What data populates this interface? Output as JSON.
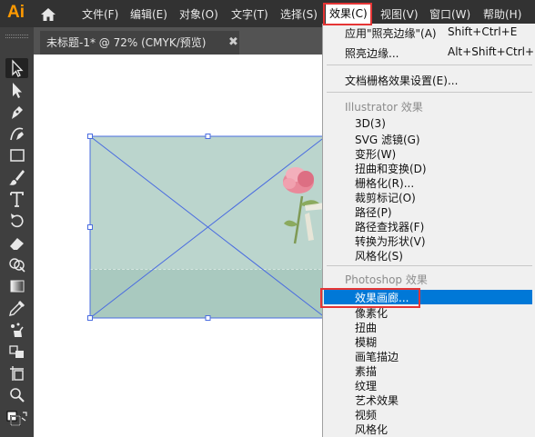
{
  "app": {
    "logo": "Ai",
    "icons": [
      "home-icon"
    ]
  },
  "menubar": {
    "items": [
      "文件(F)",
      "编辑(E)",
      "对象(O)",
      "文字(T)",
      "选择(S)",
      "效果(C)",
      "视图(V)",
      "窗口(W)",
      "帮助(H)"
    ],
    "active": "效果(C)"
  },
  "document": {
    "tab_title": "未标题-1* @ 72% (CMYK/预览)",
    "close_glyph": "✖"
  },
  "tools": [
    "selection-tool",
    "direct-selection-tool",
    "pen-tool",
    "curvature-tool",
    "rectangle-tool",
    "paintbrush-tool",
    "type-tool",
    "rotate-tool",
    "eraser-tool",
    "shape-builder-tool",
    "gradient-tool",
    "eyedropper-tool",
    "symbol-sprayer-tool",
    "puppet-warp-tool",
    "artboard-tool",
    "zoom-tool",
    "fill-stroke-swatch"
  ],
  "effects_menu": {
    "apply_last": {
      "label": "应用\"照亮边缘\"(A)",
      "shortcut": "Shift+Ctrl+E"
    },
    "last_effect": {
      "label": "照亮边缘...",
      "shortcut": "Alt+Shift+Ctrl+E"
    },
    "raster_settings": "文档栅格效果设置(E)...",
    "illustrator_header": "Illustrator 效果",
    "illustrator_items": [
      "3D(3)",
      "SVG 滤镜(G)",
      "变形(W)",
      "扭曲和变换(D)",
      "栅格化(R)...",
      "裁剪标记(O)",
      "路径(P)",
      "路径查找器(F)",
      "转换为形状(V)",
      "风格化(S)"
    ],
    "photoshop_header": "Photoshop 效果",
    "photoshop_highlighted": "效果画廊...",
    "photoshop_items": [
      "像素化",
      "扭曲",
      "模糊",
      "画笔描边",
      "素描",
      "纹理",
      "艺术效果",
      "视频",
      "风格化"
    ]
  },
  "colors": {
    "menubar_bg": "#323232",
    "accent_logo": "#FF9A00",
    "selection_blue": "#0078D7",
    "annotation_red": "#E53535",
    "artboard_fill": "#BBD5CD"
  }
}
